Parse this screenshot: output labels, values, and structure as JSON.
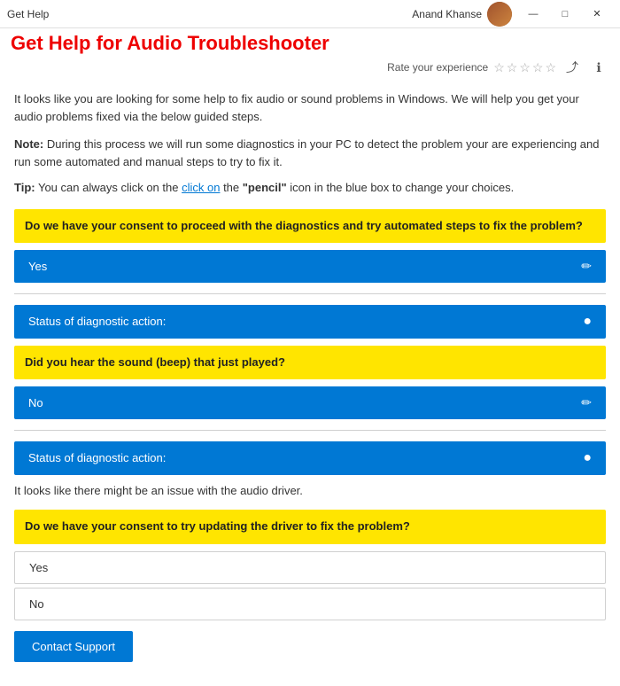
{
  "titleBar": {
    "appName": "Get Help",
    "userName": "Anand Khanse",
    "winButtons": {
      "minimize": "—",
      "maximize": "□",
      "close": "✕"
    }
  },
  "header": {
    "title": "Get Help for Audio Troubleshooter",
    "ratingLabel": "Rate your experience"
  },
  "content": {
    "introText": "It looks like you are looking for some help to fix audio or sound problems in Windows. We will help you get your audio problems fixed via the below guided steps.",
    "noteLabel": "Note:",
    "noteText": " During this process we will run some diagnostics in your PC to detect the problem your are experiencing and run some automated  and manual steps to try to fix it.",
    "tipLabel": "Tip:",
    "tipText": " You can always click on the ",
    "tipPencil": "\"pencil\"",
    "tipTextEnd": " icon in the blue box to change your choices.",
    "question1": "Do we have your consent to proceed with the diagnostics and try automated steps to fix the problem?",
    "answer1": "Yes",
    "statusLabel1": "Status of diagnostic action:",
    "question2": "Did you hear the sound (beep) that just played?",
    "answer2": "No",
    "statusLabel2": "Status of diagnostic action:",
    "issueText": "It looks like there might be an issue with the audio driver.",
    "question3": "Do we have your consent to try updating the driver to fix the problem?",
    "option1": "Yes",
    "option2": "No",
    "contactSupport": "Contact Support"
  },
  "icons": {
    "pencil": "✏",
    "checkCircle": "✔",
    "share": "⤴",
    "info": "ℹ"
  }
}
